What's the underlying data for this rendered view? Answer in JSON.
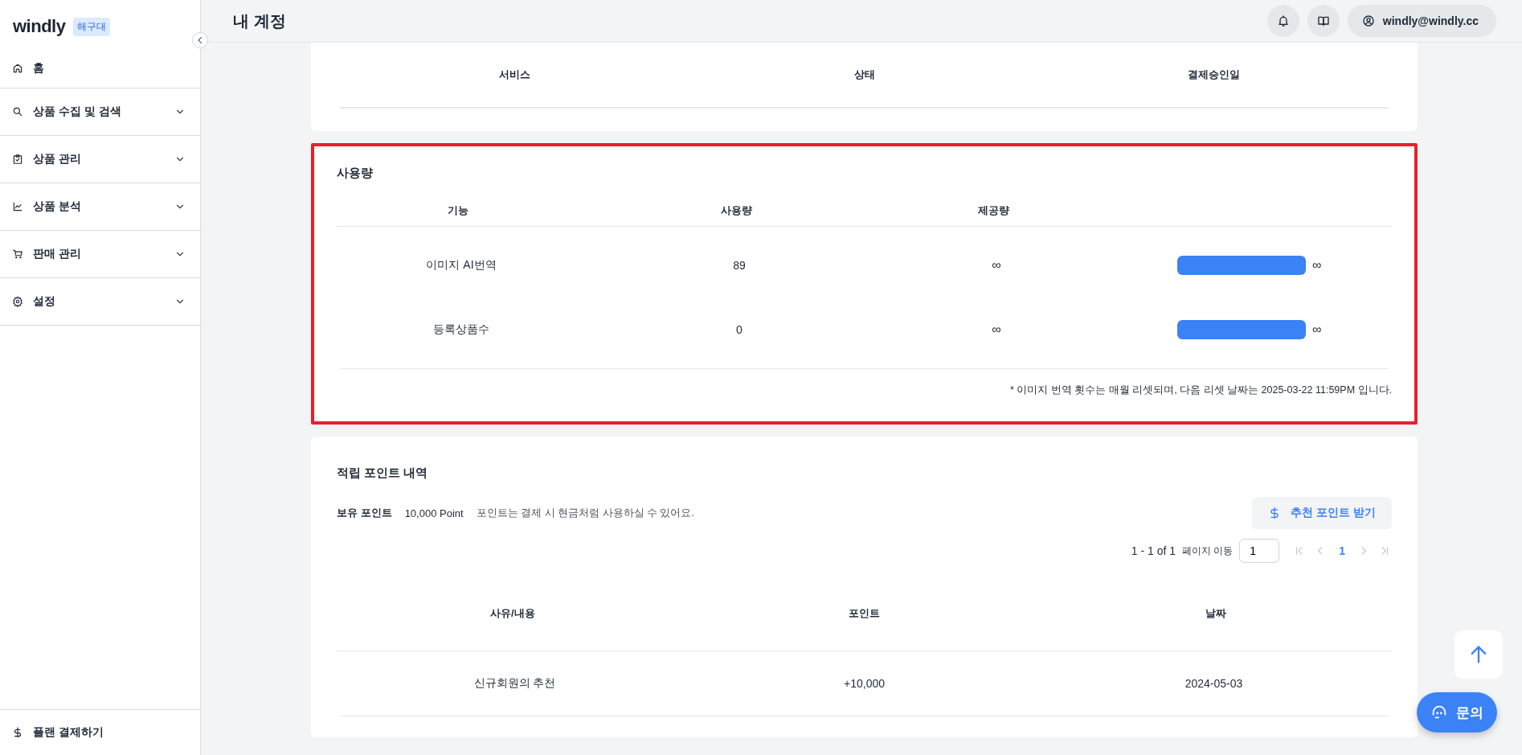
{
  "sidebar": {
    "logo": "windly",
    "badge": "해구대",
    "items": [
      {
        "label": "홈",
        "expandable": false
      },
      {
        "label": "상품 수집 및 검색",
        "expandable": true
      },
      {
        "label": "상품 관리",
        "expandable": true
      },
      {
        "label": "상품 분석",
        "expandable": true
      },
      {
        "label": "판매 관리",
        "expandable": true
      },
      {
        "label": "설정",
        "expandable": true
      }
    ],
    "footer": {
      "label": "플랜 결제하기"
    }
  },
  "header": {
    "title": "내 계정",
    "user": "windly@windly.cc"
  },
  "subscription": {
    "columns": [
      "서비스",
      "상태",
      "결제승인일"
    ]
  },
  "usage": {
    "title": "사용량",
    "highlighted": true,
    "columns": [
      "기능",
      "사용량",
      "제공량"
    ],
    "rows": [
      {
        "feature": "이미지 AI번역",
        "used": "89",
        "provided": "∞",
        "level": 1,
        "limit": "∞"
      },
      {
        "feature": "등록상품수",
        "used": "0",
        "provided": "∞",
        "level": 1,
        "limit": "∞"
      }
    ],
    "note": "* 이미지 번역 횟수는 매월 리셋되며, 다음 리셋 날짜는 2025-03-22 11:59PM 입니다."
  },
  "points": {
    "title": "적립 포인트 내역",
    "balance_label": "보유 포인트",
    "balance": "10,000 Point",
    "hint": "포인트는 결제 시 현금처럼 사용하실 수 있어요.",
    "button": "추천 포인트 받기",
    "pagination": {
      "range": "1 - 1 of 1",
      "goto_label": "페이지 이동",
      "goto_value": "1",
      "pages": [
        {
          "label": "1",
          "selected": true
        }
      ]
    },
    "columns": [
      "사유/내용",
      "포인트",
      "날짜"
    ],
    "rows": [
      [
        "신규회원의 추천",
        "+10,000",
        "2024-05-03"
      ]
    ]
  },
  "floating": {
    "contact": "문의"
  }
}
